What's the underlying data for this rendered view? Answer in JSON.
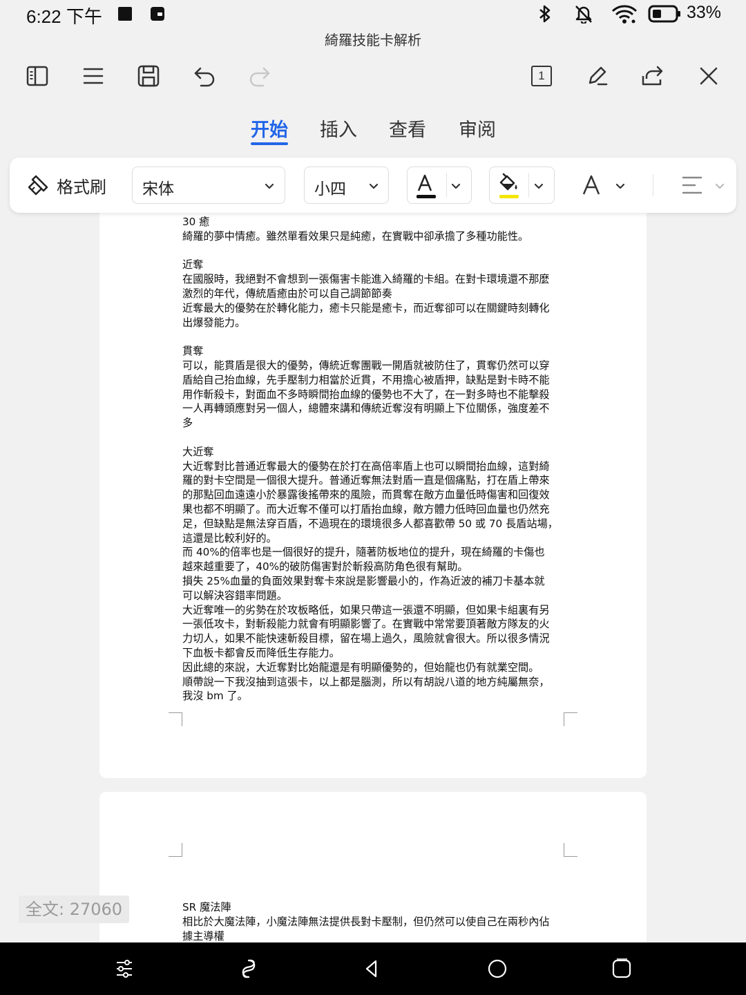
{
  "status_bar": {
    "time": "6:22 下午",
    "battery": "33%"
  },
  "document_title": "綺羅技能卡解析",
  "toolbar": {
    "page_count": "1"
  },
  "tabs": [
    "开始",
    "插入",
    "查看",
    "审阅"
  ],
  "format_bar": {
    "format_painter": "格式刷",
    "font_name": "宋体",
    "font_size": "小四",
    "font_color": "#111111",
    "highlight_color": "#f3e600",
    "accent": "#2266e8"
  },
  "page1_lines": [
    "30 癒",
    "綺羅的夢中情癒。雖然單看效果只是純癒，在實戰中卻承擔了多種功能性。",
    "",
    "近奪",
    "在國服時，我絕對不會想到一張傷害卡能進入綺羅的卡組。在對卡環境還不那麼",
    "激烈的年代，傳統盾癒由於可以自己調節節奏",
    "近奪最大的優勢在於轉化能力，癒卡只能是癒卡，而近奪卻可以在關鍵時刻轉化",
    "出爆發能力。",
    "",
    "貫奪",
    "可以，能貫盾是很大的優勢，傳統近奪團戰一開盾就被防住了，貫奪仍然可以穿",
    "盾給自己抬血線，先手壓制力相當於近貫，不用擔心被盾押，缺點是對卡時不能",
    "用作斬殺卡，對面血不多時瞬間抬血線的優勢也不大了，在一對多時也不能擊殺",
    "一人再轉頭應對另一個人，總體來講和傳統近奪沒有明顯上下位關係，強度差不",
    "多",
    "",
    "大近奪",
    "大近奪對比普通近奪最大的優勢在於打在高倍率盾上也可以瞬間抬血線，這對綺",
    "羅的對卡空間是一個很大提升。普通近奪無法對盾一直是個痛點，打在盾上帶來",
    "的那點回血遠遠小於暴露後搖帶來的風險，而貫奪在敵方血量低時傷害和回復效",
    "果也都不明顯了。而大近奪不僅可以打盾抬血線，敵方體力低時回血量也仍然充",
    "足，但缺點是無法穿百盾，不過現在的環境很多人都喜歡帶 50 或 70 長盾站場，",
    "這還是比較利好的。",
    "而 40%的倍率也是一個很好的提升，隨著防板地位的提升，現在綺羅的卡傷也",
    "越來越重要了，40%的破防傷害對於斬殺高防角色很有幫助。",
    "損失 25%血量的負面效果對奪卡來說是影響最小的，作為近波的補刀卡基本就",
    "可以解決容錯率問題。",
    "大近奪唯一的劣勢在於攻板略低，如果只帶這一張還不明顯，但如果卡組裏有另",
    "一張低攻卡，對斬殺能力就會有明顯影響了。在實戰中常常要頂著敵方隊友的火",
    "力切人，如果不能快速斬殺目標，留在場上過久，風險就會很大。所以很多情況",
    "下血板卡都會反而降低生存能力。",
    "因此總的來說，大近奪對比始龍還是有明顯優勢的，但始龍也仍有就業空間。",
    "順帶說一下我沒抽到這張卡，以上都是腦測，所以有胡說八道的地方純屬無奈，",
    "我沒 bm 了。"
  ],
  "page2_lines": [
    "SR 魔法陣",
    "相比於大魔法陣，小魔法陣無法提供長對卡壓制，但仍然可以使自己在兩秒內佔",
    "據主導權"
  ],
  "word_count": "全文: 27060"
}
